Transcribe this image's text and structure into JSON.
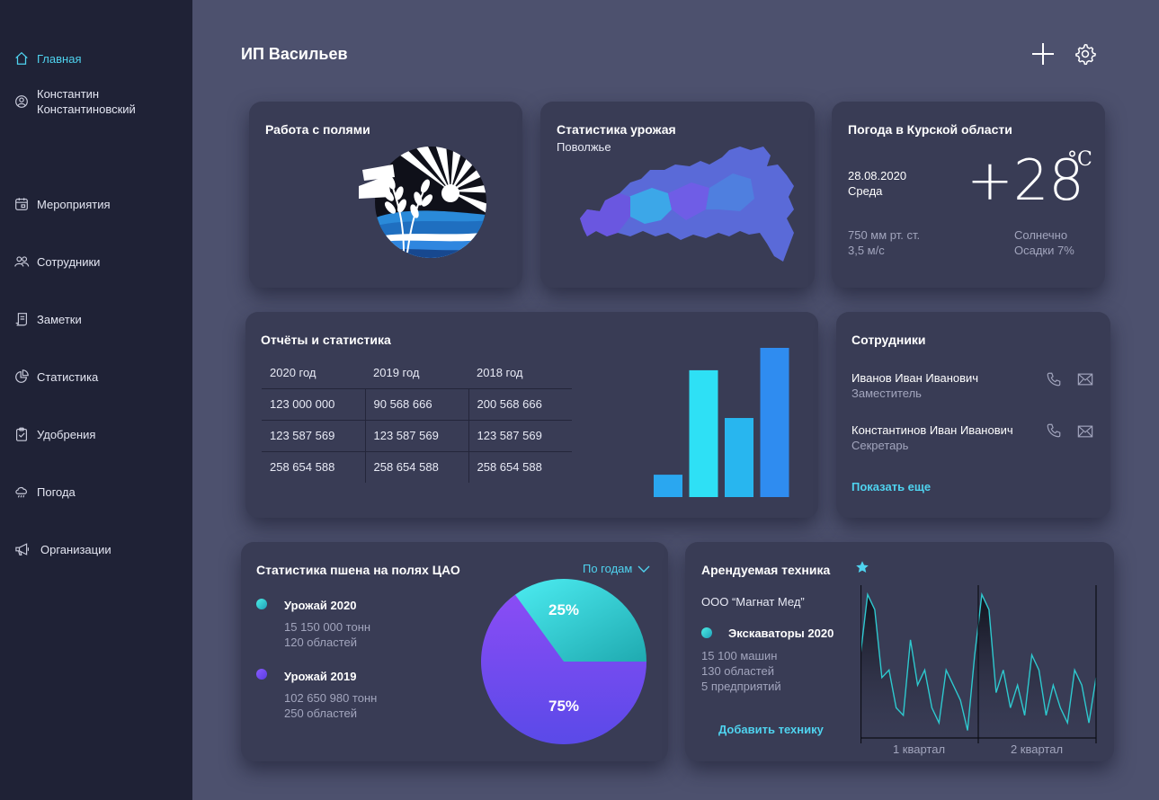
{
  "sidebar": {
    "items": [
      {
        "label": "Главная",
        "icon": "home-icon"
      },
      {
        "label": "Константин\nКонстантиновский",
        "icon": "user-icon"
      },
      {
        "label": "Мероприятия",
        "icon": "calendar-icon"
      },
      {
        "label": "Сотрудники",
        "icon": "users-icon"
      },
      {
        "label": "Заметки",
        "icon": "notes-icon"
      },
      {
        "label": "Статистика",
        "icon": "pie-chart-icon"
      },
      {
        "label": "Удобрения",
        "icon": "clipboard-icon"
      },
      {
        "label": "Погода",
        "icon": "cloud-rain-icon"
      },
      {
        "label": "Организации",
        "icon": "megaphone-icon"
      }
    ],
    "active_color": "#4fd3ef"
  },
  "header": {
    "title": "ИП Васильев",
    "add_icon": "plus-icon",
    "settings_icon": "gear-icon"
  },
  "fields_card": {
    "title": "Работа с полями"
  },
  "harvest_card": {
    "title": "Статистика урожая",
    "subtitle": "Поволжье"
  },
  "weather_card": {
    "title": "Погода в Курской области",
    "date": "28.08.2020",
    "day": "Среда",
    "temperature": "+28",
    "unit": "°C",
    "pressure": "750 мм рт. ст.",
    "wind": "3,5 м/с",
    "condition": "Солнечно",
    "precipitation": "Осадки 7%"
  },
  "reports_card": {
    "title": "Отчёты и статистика",
    "columns": [
      "2020 год",
      "2019 год",
      "2018 год"
    ],
    "rows": [
      [
        "123 000 000",
        "90 568 666",
        "200 568 666"
      ],
      [
        "123 587 569",
        "123 587 569",
        "123 587 569"
      ],
      [
        "258 654 588",
        "258 654 588",
        "258 654 588"
      ]
    ]
  },
  "employees_card": {
    "title": "Сотрудники",
    "items": [
      {
        "name": "Иванов Иван Иванович",
        "role": "Заместитель"
      },
      {
        "name": "Константинов Иван Иванович",
        "role": "Секретарь"
      }
    ],
    "show_more": "Показать еще"
  },
  "wheat_card": {
    "title": "Статистика пшена на полях ЦАО",
    "filter": "По годам",
    "legend": [
      {
        "label": "Урожай 2020",
        "line1": "15 150 000 тонн",
        "line2": "120 областей",
        "color": "#2ec9cf"
      },
      {
        "label": "Урожай 2019",
        "line1": "102 650 980 тонн",
        "line2": "250 областей",
        "color": "#7a4cf0"
      }
    ],
    "pie_labels": [
      "25%",
      "75%"
    ]
  },
  "equipment_card": {
    "title": "Арендуемая техника",
    "company": "ООО “Магнат Мед”",
    "category": "Экскаваторы 2020",
    "stats": [
      "15 100 машин",
      "130 областей",
      "5 предприятий"
    ],
    "add_link": "Добавить технику",
    "dot_color": "#2ec9cf"
  },
  "chart_data": [
    {
      "type": "bar",
      "values": [
        15,
        85,
        53,
        100
      ],
      "colors": [
        "#2aa7f0",
        "#2ee0f5",
        "#28b6ef",
        "#2f8cf0"
      ]
    },
    {
      "type": "pie",
      "categories": [
        "Урожай 2020",
        "Урожай 2019"
      ],
      "values": [
        25,
        75
      ],
      "labels": [
        "25%",
        "75%"
      ],
      "colors": [
        "#2ed0d6",
        "#7447f0"
      ]
    },
    {
      "type": "area",
      "categories": [
        "1 квартал",
        "2 квартал"
      ],
      "values": [
        55,
        95,
        85,
        40,
        45,
        20,
        15,
        65,
        35,
        45,
        20,
        10,
        45,
        35,
        25,
        5,
        55,
        95,
        85,
        30,
        45,
        20,
        35,
        15,
        55,
        45,
        15,
        35,
        20,
        10,
        45,
        35,
        10,
        40
      ],
      "ylim": [
        0,
        100
      ],
      "color": "#2ec9cf"
    }
  ]
}
